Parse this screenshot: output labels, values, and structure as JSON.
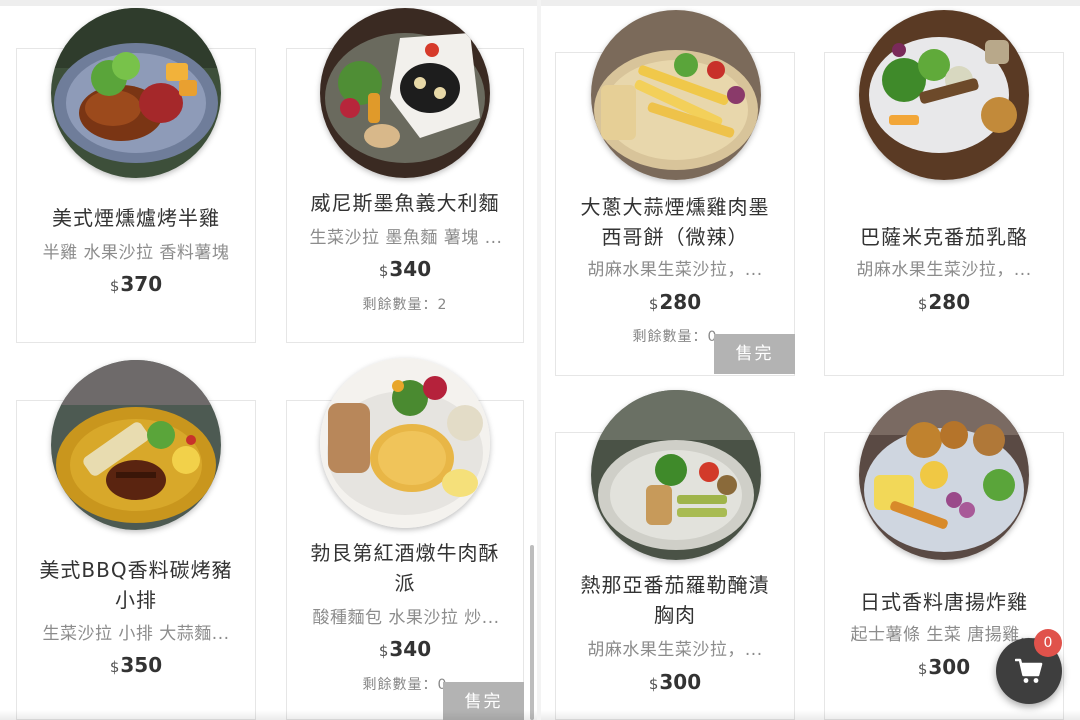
{
  "currency_symbol": "$",
  "remaining_label": "剩餘數量：",
  "sold_out_label": "售完",
  "cart": {
    "count": "0"
  },
  "left_panel": {
    "items": [
      {
        "name_l1": "美式煙燻爐烤半雞",
        "name_l2": "",
        "desc": "半雞 水果沙拉 香料薯塊",
        "price": "370",
        "remaining": "",
        "sold_out": false
      },
      {
        "name_l1": "威尼斯墨魚義大利麵",
        "name_l2": "",
        "desc": "生菜沙拉 墨魚麵 薯塊 ...",
        "price": "340",
        "remaining": "2",
        "sold_out": false
      },
      {
        "name_l1": "美式BBQ香料碳烤豬",
        "name_l2": "小排",
        "desc": "生菜沙拉 小排 大蒜麵...",
        "price": "350",
        "remaining": "",
        "sold_out": false
      },
      {
        "name_l1": "勃艮第紅酒燉牛肉酥",
        "name_l2": "派",
        "desc": "酸種麵包 水果沙拉 炒...",
        "price": "340",
        "remaining": "0",
        "sold_out": true
      }
    ]
  },
  "right_panel": {
    "items": [
      {
        "name_l1": "大蔥大蒜煙燻雞肉墨",
        "name_l2": "西哥餅（微辣）",
        "desc": "胡麻水果生菜沙拉，...",
        "price": "280",
        "remaining": "0",
        "sold_out": true
      },
      {
        "name_l1": "巴薩米克番茄乳酪",
        "name_l2": "",
        "desc": "胡麻水果生菜沙拉，...",
        "price": "280",
        "remaining": "",
        "sold_out": false
      },
      {
        "name_l1": "熱那亞番茄羅勒醃漬",
        "name_l2": "胸肉",
        "desc": "胡麻水果生菜沙拉，...",
        "price": "300",
        "remaining": "",
        "sold_out": false
      },
      {
        "name_l1": "日式香料唐揚炸雞",
        "name_l2": "",
        "desc": "起士薯條 生菜 唐揚雞...",
        "price": "300",
        "remaining": "",
        "sold_out": false
      }
    ]
  },
  "colors": {
    "sold_out_bg": "#b3b3b3",
    "cart_bg": "#3e3e3e",
    "badge_bg": "#e0524b",
    "text": "#333333",
    "desc_text": "#8c8c8c"
  },
  "icons": {
    "cart": "shopping-cart-icon"
  }
}
